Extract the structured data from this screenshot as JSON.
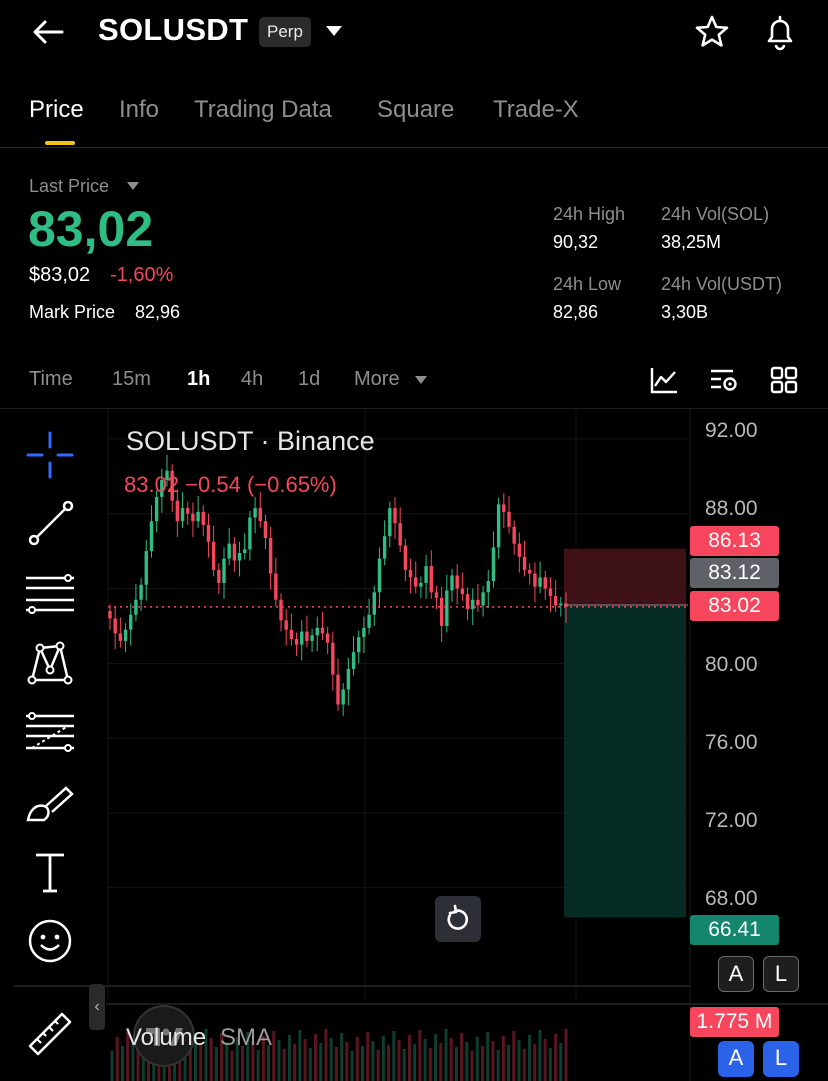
{
  "header": {
    "symbol": "SOLUSDT",
    "contract_type": "Perp"
  },
  "tabs": [
    {
      "label": "Price",
      "active": true
    },
    {
      "label": "Info",
      "active": false
    },
    {
      "label": "Trading Data",
      "active": false
    },
    {
      "label": "Square",
      "active": false
    },
    {
      "label": "Trade-X",
      "active": false
    }
  ],
  "price_panel": {
    "last_price_label": "Last Price",
    "last_price": "83,02",
    "usd_price": "$83,02",
    "change_pct": "-1,60%",
    "mark_price_label": "Mark Price",
    "mark_price": "82,96"
  },
  "stats": {
    "high_label": "24h High",
    "high": "90,32",
    "vol_sol_label": "24h Vol(SOL)",
    "vol_sol": "38,25M",
    "low_label": "24h Low",
    "low": "82,86",
    "vol_usdt_label": "24h Vol(USDT)",
    "vol_usdt": "3,30B"
  },
  "intervals": [
    {
      "label": "Time",
      "active": false
    },
    {
      "label": "15m",
      "active": false
    },
    {
      "label": "1h",
      "active": true
    },
    {
      "label": "4h",
      "active": false
    },
    {
      "label": "1d",
      "active": false
    },
    {
      "label": "More",
      "active": false
    }
  ],
  "toolbar_icons": [
    "indicator-chart-icon",
    "chart-settings-icon",
    "grid-layout-icon"
  ],
  "drawing_tools": [
    "crosshair-icon",
    "trend-line-icon",
    "horizontal-lines-icon",
    "pattern-icon",
    "fib-levels-icon",
    "brush-icon",
    "text-icon",
    "emoji-icon",
    "ruler-icon"
  ],
  "chart": {
    "title": "SOLUSDT · Binance",
    "ohlc_text": "83.02  −0.54 (−0.65%)",
    "volume_label": "Volume",
    "volume_sma_label": "SMA",
    "volume_tag": "1.775 M",
    "btn_a": "A",
    "btn_l": "L",
    "colors": {
      "up": "#2ebd85",
      "down": "#f6465d",
      "gray_tag": "#5e6167"
    }
  },
  "chart_data": {
    "type": "candlestick",
    "title": "SOLUSDT · Binance",
    "ylim": [
      62.0,
      93.6
    ],
    "y_ticks": [
      92.0,
      88.0,
      80.0,
      76.0,
      72.0,
      68.0
    ],
    "y_tick_labels": [
      "92.00",
      "88.00",
      "80.00",
      "76.00",
      "72.00",
      "68.00"
    ],
    "price_tags": [
      {
        "label": "86.13",
        "value": 86.13,
        "color": "#f6465d"
      },
      {
        "label": "83.12",
        "value": 83.12,
        "color": "#5e6167"
      },
      {
        "label": "83.02",
        "value": 83.02,
        "color": "#f6465d"
      },
      {
        "label": "66.41",
        "value": 66.41,
        "color": "#14866d"
      }
    ],
    "position": {
      "entry": 83.12,
      "stop_loss": 86.13,
      "take_profit": 66.41
    },
    "last_price": 83.02,
    "closes": [
      82.4,
      81.6,
      81.2,
      81.8,
      82.6,
      83.4,
      84.2,
      86.0,
      87.6,
      88.9,
      89.8,
      90.3,
      88.7,
      87.6,
      88.3,
      88.0,
      87.6,
      88.1,
      87.4,
      86.5,
      85.0,
      84.3,
      85.6,
      86.4,
      85.5,
      85.9,
      86.1,
      87.8,
      88.3,
      87.6,
      86.7,
      84.8,
      83.4,
      82.3,
      81.8,
      81.3,
      81.0,
      81.7,
      81.2,
      81.5,
      81.9,
      81.6,
      81.1,
      79.4,
      77.8,
      78.6,
      79.7,
      80.6,
      81.4,
      81.9,
      82.6,
      83.8,
      85.6,
      86.8,
      88.3,
      87.5,
      86.3,
      85.0,
      84.6,
      84.1,
      84.3,
      85.2,
      83.8,
      83.5,
      82.0,
      83.9,
      84.7,
      84.0,
      83.7,
      82.9,
      83.4,
      83.1,
      83.8,
      84.4,
      86.2,
      88.5,
      88.1,
      87.3,
      86.4,
      85.7,
      85.0,
      84.8,
      84.1,
      84.6,
      84.0,
      83.6,
      83.1,
      83.2,
      83.02
    ],
    "volume_bars": 88
  }
}
